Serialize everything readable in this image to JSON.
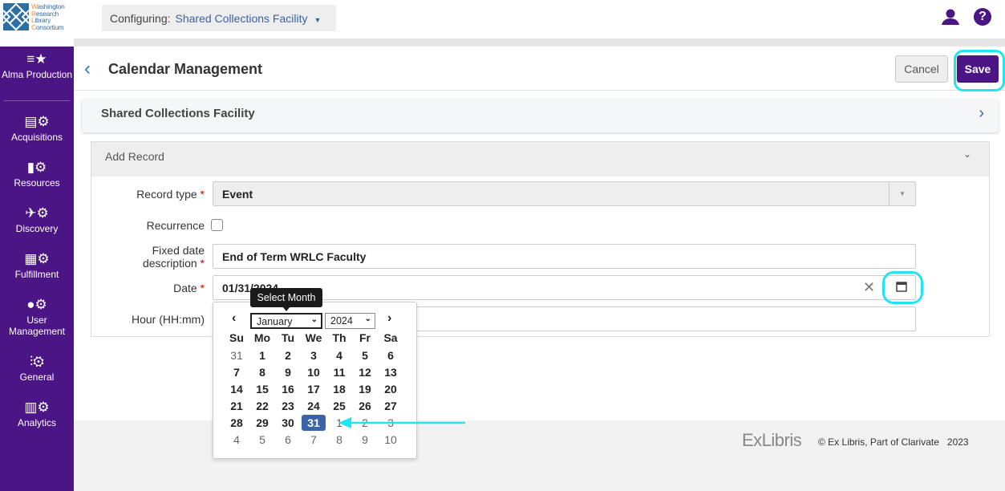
{
  "header": {
    "logo_lines": [
      "Washington",
      "Research",
      "Library",
      "Consortium"
    ],
    "configuring_label": "Configuring:",
    "configuring_value": "Shared Collections Facility",
    "user_icon": "user-icon",
    "help_icon": "help-icon"
  },
  "sidebar": {
    "items": [
      {
        "label": "Alma Production",
        "icon": "list-star"
      },
      {
        "label": "Acquisitions",
        "icon": "abacus-gear"
      },
      {
        "label": "Resources",
        "icon": "books-gear"
      },
      {
        "label": "Discovery",
        "icon": "telescope-gear"
      },
      {
        "label": "Fulfillment",
        "icon": "shelf-gear"
      },
      {
        "label": "User Management",
        "icon": "user-gear"
      },
      {
        "label": "General",
        "icon": "sliders-gear"
      },
      {
        "label": "Analytics",
        "icon": "chart-gear"
      }
    ]
  },
  "page": {
    "title": "Calendar Management",
    "cancel": "Cancel",
    "save": "Save"
  },
  "panel": {
    "title": "Shared Collections Facility"
  },
  "form": {
    "title": "Add Record",
    "record_type_label": "Record type",
    "record_type_value": "Event",
    "recurrence_label": "Recurrence",
    "recurrence_checked": false,
    "fixed_desc_label_1": "Fixed date",
    "fixed_desc_label_2": "description",
    "fixed_desc_value": "End of Term WRLC Faculty",
    "date_label": "Date",
    "date_value": "01/31/2024",
    "hour_label": "Hour (HH:mm)",
    "hour_value": "",
    "required_mark": "*"
  },
  "calendar": {
    "tooltip": "Select Month",
    "month": "January",
    "year": "2024",
    "weekdays": [
      "Su",
      "Mo",
      "Tu",
      "We",
      "Th",
      "Fr",
      "Sa"
    ],
    "weeks": [
      [
        "31",
        "1",
        "2",
        "3",
        "4",
        "5",
        "6"
      ],
      [
        "7",
        "8",
        "9",
        "10",
        "11",
        "12",
        "13"
      ],
      [
        "14",
        "15",
        "16",
        "17",
        "18",
        "19",
        "20"
      ],
      [
        "21",
        "22",
        "23",
        "24",
        "25",
        "26",
        "27"
      ],
      [
        "28",
        "29",
        "30",
        "31",
        "1",
        "2",
        "3"
      ],
      [
        "4",
        "5",
        "6",
        "7",
        "8",
        "9",
        "10"
      ]
    ],
    "selected": "31"
  },
  "annotations": {
    "highlight_color": "#1ee5f0"
  },
  "footer": {
    "brand": "ExLibris",
    "copyright": "© Ex Libris, Part of Clarivate   2023"
  },
  "colors": {
    "brand_purple": "#4b1585",
    "link_blue": "#3b63a8"
  }
}
